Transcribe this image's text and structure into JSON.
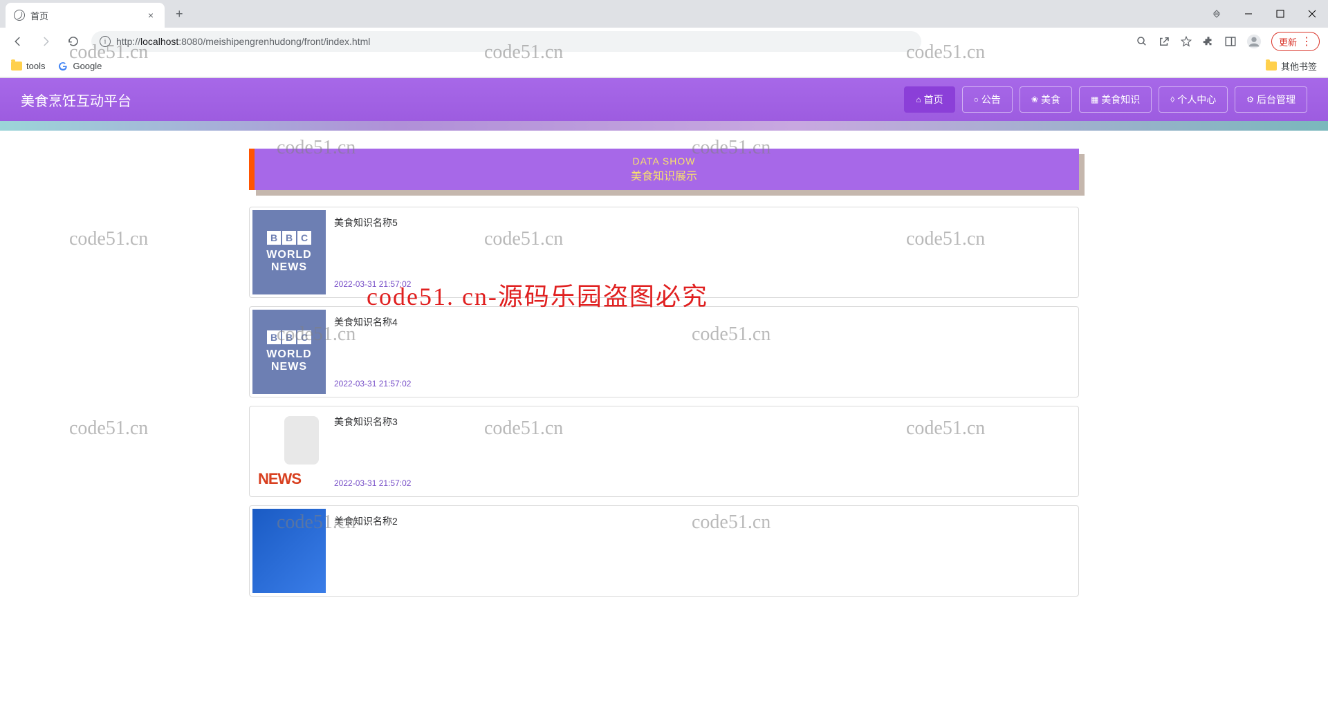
{
  "browser": {
    "tab_title": "首页",
    "url_display": "http://localhost:8080/meishipengrenhudong/front/index.html",
    "url_host": "localhost",
    "url_port": ":8080",
    "url_path": "/meishipengrenhudong/front/index.html",
    "update_label": "更新",
    "bookmarks": {
      "tools": "tools",
      "google": "Google",
      "other": "其他书签"
    }
  },
  "nav": {
    "brand": "美食烹饪互动平台",
    "links": [
      {
        "icon": "⌂",
        "label": "首页",
        "active": true
      },
      {
        "icon": "○",
        "label": "公告",
        "active": false
      },
      {
        "icon": "❀",
        "label": "美食",
        "active": false
      },
      {
        "icon": "▦",
        "label": "美食知识",
        "active": false
      },
      {
        "icon": "◊",
        "label": "个人中心",
        "active": false
      },
      {
        "icon": "⚙",
        "label": "后台管理",
        "active": false
      }
    ]
  },
  "section": {
    "subtitle": "DATA SHOW",
    "title": "美食知识展示"
  },
  "cards": [
    {
      "title": "美食知识名称5",
      "date": "2022-03-31 21:57:02",
      "thumb": "bbc"
    },
    {
      "title": "美食知识名称4",
      "date": "2022-03-31 21:57:02",
      "thumb": "bbc"
    },
    {
      "title": "美食知识名称3",
      "date": "2022-03-31 21:57:02",
      "thumb": "news"
    },
    {
      "title": "美食知识名称2",
      "date": "",
      "thumb": "blue"
    }
  ],
  "thumb_text": {
    "bbc_b": "B",
    "bbc_c": "C",
    "world": "WORLD",
    "news": "NEWS",
    "news_word": "NEWS"
  },
  "watermarks": {
    "grey": "code51.cn",
    "red": "code51. cn-源码乐园盗图必究"
  }
}
